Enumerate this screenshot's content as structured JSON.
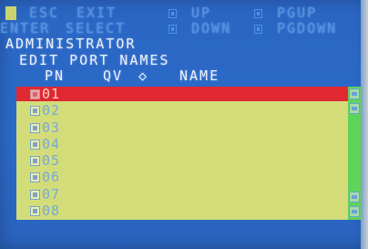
{
  "hints": {
    "esc": {
      "key": "ESC",
      "action": "EXIT"
    },
    "enter": {
      "key": "ENTER",
      "action": "SELECT"
    },
    "up": {
      "action": "UP"
    },
    "down": {
      "action": "DOWN"
    },
    "pgup": {
      "action": "PGUP"
    },
    "pgdown": {
      "action": "PGDOWN"
    }
  },
  "user": "ADMINISTRATOR",
  "menu_title": "EDIT PORT NAMES",
  "columns": {
    "pn": "PN",
    "qv": "QV",
    "qv_icon": "◇",
    "name": "NAME"
  },
  "ports": [
    {
      "pn": "01",
      "name": "",
      "selected": true
    },
    {
      "pn": "02",
      "name": "",
      "selected": false
    },
    {
      "pn": "03",
      "name": "",
      "selected": false
    },
    {
      "pn": "04",
      "name": "",
      "selected": false
    },
    {
      "pn": "05",
      "name": "",
      "selected": false
    },
    {
      "pn": "06",
      "name": "",
      "selected": false
    },
    {
      "pn": "07",
      "name": "",
      "selected": false
    },
    {
      "pn": "08",
      "name": "",
      "selected": false
    }
  ],
  "colors": {
    "background": "#2c6bc9",
    "panel": "#d2dd7a",
    "selected_row": "#e02831",
    "scrollbar": "#5fd45a"
  }
}
